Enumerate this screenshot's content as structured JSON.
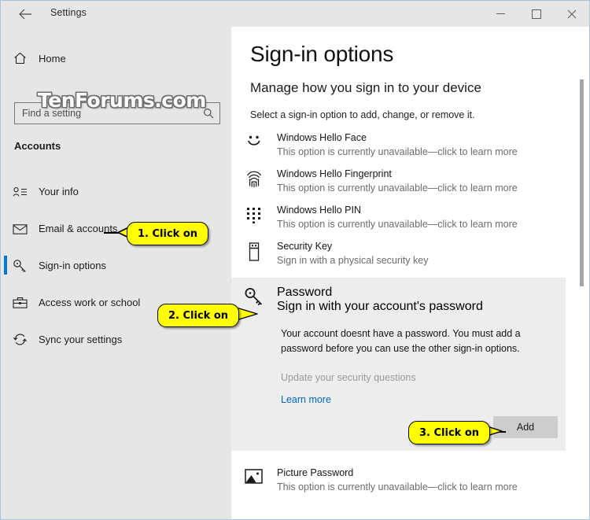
{
  "window": {
    "title": "Settings",
    "back_icon": "back-arrow-icon",
    "minimize_label": "–",
    "maximize_label": "□",
    "close_label": "✕"
  },
  "watermark": {
    "text": "TenForums.com"
  },
  "sidebar": {
    "home_label": "Home",
    "home_icon": "home-icon",
    "search": {
      "placeholder": "Find a setting",
      "value": "",
      "icon": "search-icon"
    },
    "section_header": "Accounts",
    "items": [
      {
        "label": "Your info",
        "icon": "contact-card-icon",
        "selected": false
      },
      {
        "label": "Email & accounts",
        "icon": "envelope-icon",
        "selected": false
      },
      {
        "label": "Sign-in options",
        "icon": "key-icon",
        "selected": true
      },
      {
        "label": "Access work or school",
        "icon": "briefcase-icon",
        "selected": false
      },
      {
        "label": "Sync your settings",
        "icon": "sync-icon",
        "selected": false
      }
    ]
  },
  "main": {
    "title": "Sign-in options",
    "subtitle": "Manage how you sign in to your device",
    "description": "Select a sign-in option to add, change, or remove it.",
    "options": [
      {
        "title": "Windows Hello Face",
        "subtitle": "This option is currently unavailable—click to learn more",
        "icon": "smiley-face-icon"
      },
      {
        "title": "Windows Hello Fingerprint",
        "subtitle": "This option is currently unavailable—click to learn more",
        "icon": "fingerprint-icon"
      },
      {
        "title": "Windows Hello PIN",
        "subtitle": "This option is currently unavailable—click to learn more",
        "icon": "pin-keypad-icon"
      },
      {
        "title": "Security Key",
        "subtitle": "Sign in with a physical security key",
        "icon": "usb-key-icon"
      }
    ],
    "password": {
      "title": "Password",
      "subtitle": "Sign in with your account's password",
      "icon": "key-icon",
      "message": "Your account doesnt have a password. You must add a password before you can use the other sign-in options.",
      "security_questions_link": "Update your security questions",
      "learn_more_link": "Learn more",
      "add_button": "Add"
    },
    "bottom_option": {
      "title": "Picture Password",
      "subtitle": "This option is currently unavailable—click to learn more",
      "icon": "picture-icon"
    }
  },
  "callouts": [
    {
      "text": "1. Click on"
    },
    {
      "text": "2. Click on"
    },
    {
      "text": "3. Click on"
    }
  ],
  "colors": {
    "accent": "#0078d7",
    "callout_bg": "#ffff00",
    "sidebar_bg": "#e6e6e6",
    "panel_bg": "#ededed",
    "link": "#0067c0",
    "button_bg": "#cccccc"
  }
}
